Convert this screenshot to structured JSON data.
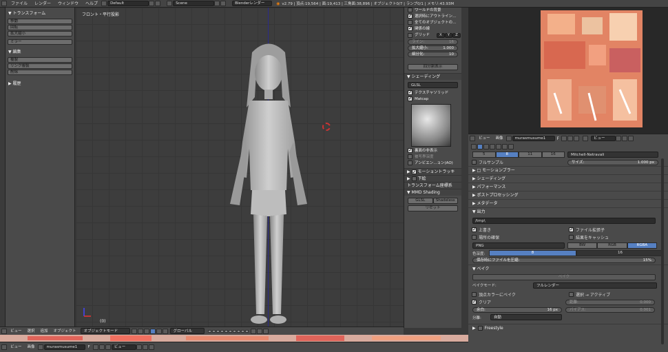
{
  "topbar": {
    "menu": [
      "ファイル",
      "レンダー",
      "ウィンドウ",
      "ヘルプ"
    ],
    "layout": "Default",
    "scene": "Scene",
    "engine": "Blenderレンダー",
    "stats": "v2.79 | 頂点:19,564 | 面:19,413 | 三角面:38,896 | オブジェクト0/7 | ランプ0/1 | メモリ:43.93M"
  },
  "toolshelf": {
    "transform_header": "▼ トランスフォーム",
    "transform_buttons": [
      "移動",
      "回転",
      "拡大縮小"
    ],
    "mirror_button": "ミラー",
    "edit_header": "▼ 編集",
    "edit_buttons": [
      "複製",
      "リンク複製",
      "削除"
    ],
    "history_header": "▶ 履歴"
  },
  "viewport": {
    "label": "フロント・平行投影",
    "frame": "(0)"
  },
  "viewport_header": {
    "menu": [
      "ビュー",
      "選択",
      "追加",
      "オブジェクト"
    ],
    "mode": "オブジェクトモード",
    "orientation": "グローバル"
  },
  "npanel": {
    "world_bg": "ワールドの背景",
    "outline_selected": "選択時にアウトライン...",
    "all_object_origins": "全てのオブジェクトの...",
    "relationship_lines": "関係の線",
    "grid": "グリッド",
    "axes": [
      "X",
      "Y",
      "Z"
    ],
    "lines_label": "ライン:",
    "lines_value": "16",
    "scale_label": "拡大縮小:",
    "scale_value": "1.000",
    "subdiv_label": "細分化:",
    "subdiv_value": "10",
    "toggle_quad": "四分割表示",
    "shading_header": "▼ シェーディング",
    "shading_mode": "GLSL",
    "texture_solid": "テクスチャソリッド",
    "matcap": "Matcap",
    "backface_culling": "裏面の非表示",
    "depth_of_field": "被写界深度",
    "ambient_occlusion": "アンビエン...ョン(AO)",
    "motion_tracking": "モーショントラッキ",
    "background": "下絵",
    "transform_orient": "トランスフォーム座標系",
    "mmd_header": "▼ MMD Shading",
    "mmd_glsl": "GLSL",
    "mmd_shadeless": "Shadeless",
    "mmd_reset": "リセット"
  },
  "image_header": {
    "menu": [
      "ビュー",
      "画像"
    ],
    "image_name": "murasmusume1",
    "f_label": "F",
    "view_mode": "ビュー"
  },
  "props": {
    "aa_samples": [
      "5",
      "8",
      "11",
      "16"
    ],
    "aa_selected": "8",
    "aa_filter": "Mitchell-Netravali",
    "full_sample": "フルサンプル",
    "size_label": "サイズ:",
    "size_value": "1.000 px",
    "panels_collapsed": [
      "▶ □ モーションブラー",
      "▶ シェーディング",
      "▶ パフォーマンス",
      "▶ ポストプロセッシング",
      "▶ メタデータ"
    ],
    "output_header": "▼ 出力",
    "output_path": "/tmp\\",
    "overwrite": "上書き",
    "file_extensions": "ファイル拡張子",
    "placeholders": "場所の確保",
    "cache_result": "結果をキャッシュ",
    "format": "PNG",
    "color_modes": [
      "BW",
      "RGB",
      "RGBA"
    ],
    "color_selected": "RGBA",
    "color_depth_label": "色深度:",
    "color_depths": [
      "8",
      "16"
    ],
    "compression": "保存時にファイルを圧縮:",
    "compression_value": "15%",
    "bake_header": "▼ ベイク",
    "bake_button": "ベイク",
    "bake_mode_label": "ベイクモード:",
    "bake_mode": "フルレンダー",
    "vertex_color": "頂点カラーにベイク",
    "selected_to_active": "選択 → アクティブ",
    "clear": "クリア",
    "distance_label": "距離:",
    "distance_value": "0.000",
    "margin_label": "余白:",
    "margin_value": "16 px",
    "bias_label": "バイアス:",
    "bias_value": "0.001",
    "split_label": "分離:",
    "split_value": "自動",
    "freestyle": "Freestyle"
  },
  "bottom_header": {
    "menu": [
      "ビュー",
      "画像"
    ],
    "image_name": "murasmusume1",
    "f_label": "F",
    "view_mode": "ビュー"
  },
  "colors": {
    "selected_blue": "#5680c2",
    "texture_orange": "#e07a5c",
    "viewport_bg": "#3d3d3d"
  }
}
